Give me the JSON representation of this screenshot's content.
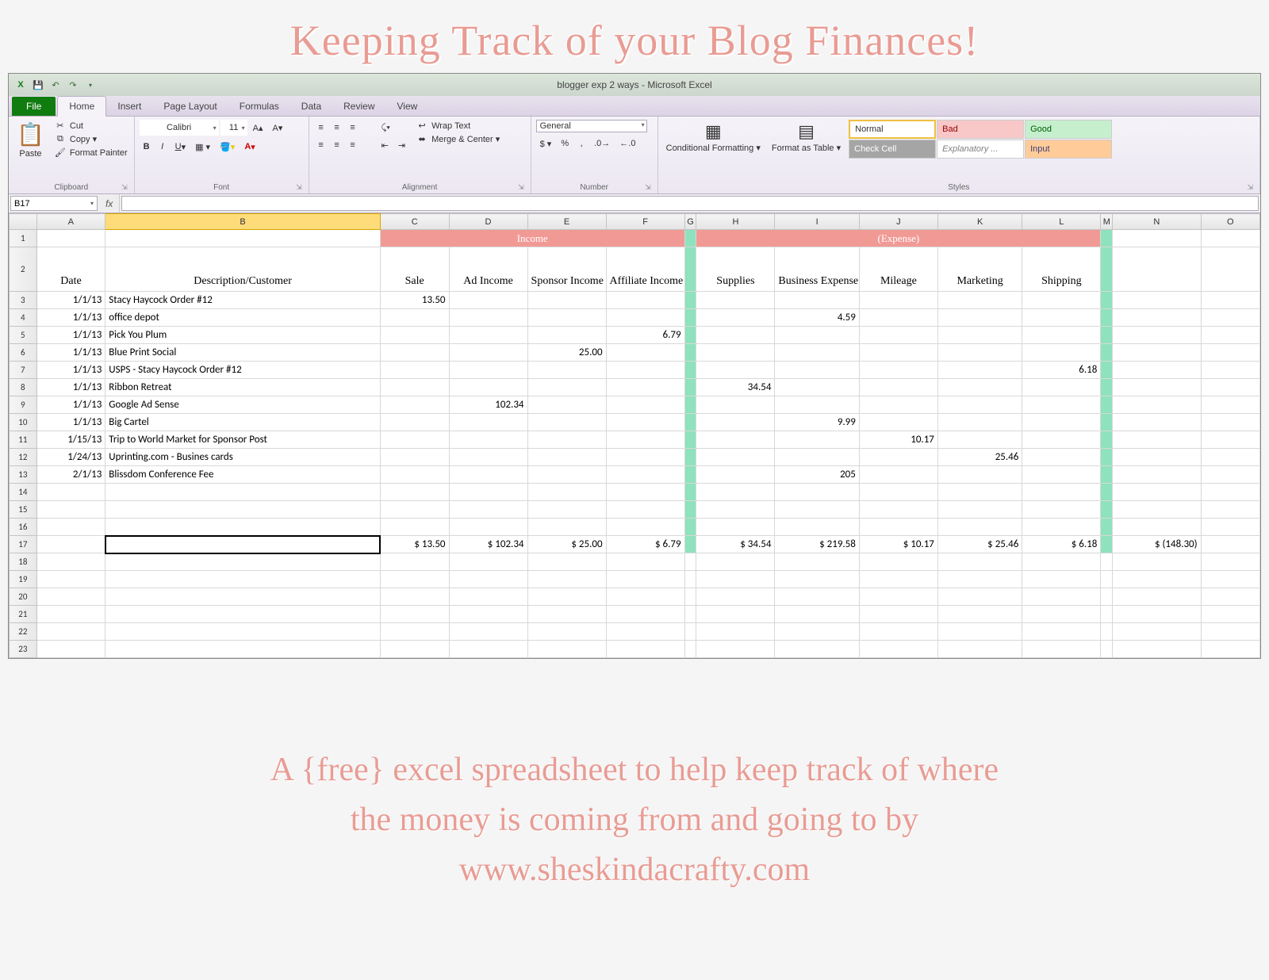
{
  "overlay": {
    "title": "Keeping Track of your Blog Finances!",
    "subtitle1": "A {free} excel spreadsheet to help keep track of where",
    "subtitle2": "the money is coming from and going to by",
    "subtitle3": "www.sheskindacrafty.com"
  },
  "window_title": "blogger exp 2 ways - Microsoft Excel",
  "tabs": {
    "file": "File",
    "list": [
      "Home",
      "Insert",
      "Page Layout",
      "Formulas",
      "Data",
      "Review",
      "View"
    ],
    "active": "Home"
  },
  "clipboard": {
    "paste": "Paste",
    "cut": "Cut",
    "copy": "Copy ▾",
    "format_painter": "Format Painter",
    "group": "Clipboard"
  },
  "font": {
    "name": "Calibri",
    "size": "11",
    "group": "Font"
  },
  "alignment": {
    "wrap": "Wrap Text",
    "merge": "Merge & Center ▾",
    "group": "Alignment"
  },
  "number": {
    "format": "General",
    "group": "Number"
  },
  "styles": {
    "conditional": "Conditional Formatting ▾",
    "format_table": "Format as Table ▾",
    "normal": "Normal",
    "bad": "Bad",
    "good": "Good",
    "check": "Check Cell",
    "explanatory": "Explanatory ...",
    "input": "Input",
    "group": "Styles"
  },
  "name_box": "B17",
  "columns": [
    "",
    "A",
    "B",
    "C",
    "D",
    "E",
    "F",
    "G",
    "H",
    "I",
    "J",
    "K",
    "L",
    "M",
    "N",
    "O"
  ],
  "section_headers": {
    "income": "Income",
    "expense": "(Expense)"
  },
  "col_headers": {
    "date": "Date",
    "desc": "Description/Customer",
    "sale": "Sale",
    "ad": "Ad Income",
    "sponsor": "Sponsor Income",
    "affiliate": "Affiliate Income",
    "supplies": "Supplies",
    "business": "Business Expense",
    "mileage": "Mileage",
    "marketing": "Marketing",
    "shipping": "Shipping"
  },
  "rows": [
    {
      "n": "3",
      "date": "1/1/13",
      "desc": "Stacy Haycock Order #12",
      "sale": "13.50"
    },
    {
      "n": "4",
      "date": "1/1/13",
      "desc": "office depot",
      "business": "4.59"
    },
    {
      "n": "5",
      "date": "1/1/13",
      "desc": "Pick You Plum",
      "affiliate": "6.79"
    },
    {
      "n": "6",
      "date": "1/1/13",
      "desc": "Blue Print Social",
      "sponsor": "25.00"
    },
    {
      "n": "7",
      "date": "1/1/13",
      "desc": "USPS - Stacy Haycock Order #12",
      "shipping": "6.18"
    },
    {
      "n": "8",
      "date": "1/1/13",
      "desc": "Ribbon Retreat",
      "supplies": "34.54"
    },
    {
      "n": "9",
      "date": "1/1/13",
      "desc": "Google Ad Sense",
      "ad": "102.34"
    },
    {
      "n": "10",
      "date": "1/1/13",
      "desc": "Big Cartel",
      "business": "9.99"
    },
    {
      "n": "11",
      "date": "1/15/13",
      "desc": "Trip to World Market for Sponsor Post",
      "mileage": "10.17"
    },
    {
      "n": "12",
      "date": "1/24/13",
      "desc": "Uprinting.com - Busines cards",
      "marketing": "25.46"
    },
    {
      "n": "13",
      "date": "2/1/13",
      "desc": "Blissdom Conference Fee",
      "business": "205"
    }
  ],
  "empty_rows": [
    "14",
    "15",
    "16"
  ],
  "totals": {
    "row": "17",
    "sale": "$    13.50",
    "ad": "$   102.34",
    "sponsor": "$     25.00",
    "affiliate": "$      6.79",
    "supplies": "$     34.54",
    "business": "$   219.58",
    "mileage": "$     10.17",
    "marketing": "$     25.46",
    "shipping": "$      6.18",
    "net": "$  (148.30)"
  },
  "tail_rows": [
    "18",
    "19",
    "20",
    "21",
    "22",
    "23"
  ],
  "chart_data": {
    "type": "table",
    "columns": [
      "Date",
      "Description/Customer",
      "Sale",
      "Ad Income",
      "Sponsor Income",
      "Affiliate Income",
      "Supplies",
      "Business Expense",
      "Mileage",
      "Marketing",
      "Shipping"
    ],
    "rows": [
      [
        "1/1/13",
        "Stacy Haycock Order #12",
        13.5,
        null,
        null,
        null,
        null,
        null,
        null,
        null,
        null
      ],
      [
        "1/1/13",
        "office depot",
        null,
        null,
        null,
        null,
        null,
        4.59,
        null,
        null,
        null
      ],
      [
        "1/1/13",
        "Pick You Plum",
        null,
        null,
        null,
        6.79,
        null,
        null,
        null,
        null,
        null
      ],
      [
        "1/1/13",
        "Blue Print Social",
        null,
        null,
        25.0,
        null,
        null,
        null,
        null,
        null,
        null
      ],
      [
        "1/1/13",
        "USPS - Stacy Haycock Order #12",
        null,
        null,
        null,
        null,
        null,
        null,
        null,
        null,
        6.18
      ],
      [
        "1/1/13",
        "Ribbon Retreat",
        null,
        null,
        null,
        null,
        34.54,
        null,
        null,
        null,
        null
      ],
      [
        "1/1/13",
        "Google Ad Sense",
        null,
        102.34,
        null,
        null,
        null,
        null,
        null,
        null,
        null
      ],
      [
        "1/1/13",
        "Big Cartel",
        null,
        null,
        null,
        null,
        null,
        9.99,
        null,
        null,
        null
      ],
      [
        "1/15/13",
        "Trip to World Market for Sponsor Post",
        null,
        null,
        null,
        null,
        null,
        null,
        10.17,
        null,
        null
      ],
      [
        "1/24/13",
        "Uprinting.com - Busines cards",
        null,
        null,
        null,
        null,
        null,
        null,
        null,
        25.46,
        null
      ],
      [
        "2/1/13",
        "Blissdom Conference Fee",
        null,
        null,
        null,
        null,
        null,
        205,
        null,
        null,
        null
      ]
    ],
    "totals": {
      "Sale": 13.5,
      "Ad Income": 102.34,
      "Sponsor Income": 25.0,
      "Affiliate Income": 6.79,
      "Supplies": 34.54,
      "Business Expense": 219.58,
      "Mileage": 10.17,
      "Marketing": 25.46,
      "Shipping": 6.18,
      "Net": -148.3
    }
  }
}
